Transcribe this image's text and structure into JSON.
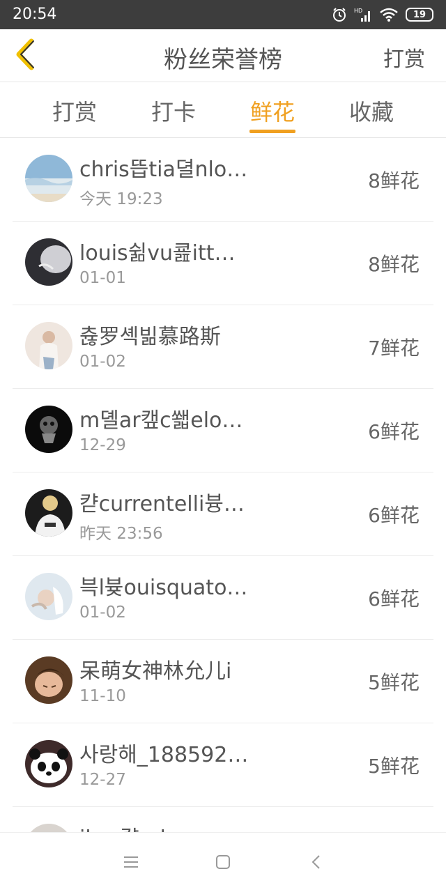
{
  "status_bar": {
    "time": "20:54",
    "battery": "19",
    "icons": [
      "alarm-icon",
      "signal-icon",
      "wifi-icon",
      "battery-icon"
    ]
  },
  "header": {
    "title": "粉丝荣誉榜",
    "action": "打赏",
    "back_icon": "chevron-left-icon"
  },
  "tabs": [
    {
      "label": "打赏",
      "active": false
    },
    {
      "label": "打卡",
      "active": false
    },
    {
      "label": "鲜花",
      "active": true
    },
    {
      "label": "收藏",
      "active": false
    }
  ],
  "colors": {
    "accent": "#f0a020",
    "status_bar": "#3d3d3d",
    "text": "#555555",
    "subtext": "#999999"
  },
  "list": [
    {
      "name": "chris뜹tia뎔nlo…",
      "time": "今天 19:23",
      "count": "8鲜花"
    },
    {
      "name": "louis쉶vu쿒itt…",
      "time": "01-01",
      "count": "8鲜花"
    },
    {
      "name": "츊罗셱빎慕路斯",
      "time": "01-02",
      "count": "7鲜花"
    },
    {
      "name": "m뎰ar캪c쐛elo…",
      "time": "12-29",
      "count": "6鲜花"
    },
    {
      "name": "캳currentelli븅…",
      "time": "昨天 23:56",
      "count": "6鲜花"
    },
    {
      "name": "븍l븆ouisquato…",
      "time": "01-02",
      "count": "6鲜花"
    },
    {
      "name": "呆萌女神林允儿i",
      "time": "11-10",
      "count": "5鲜花"
    },
    {
      "name": "사랑해_188592…",
      "time": "12-27",
      "count": "5鲜花"
    },
    {
      "name": "ibra캵nd",
      "time": "",
      "count": ""
    }
  ],
  "nav_bar": {
    "icons": [
      "menu-icon",
      "home-icon",
      "back-icon"
    ]
  }
}
